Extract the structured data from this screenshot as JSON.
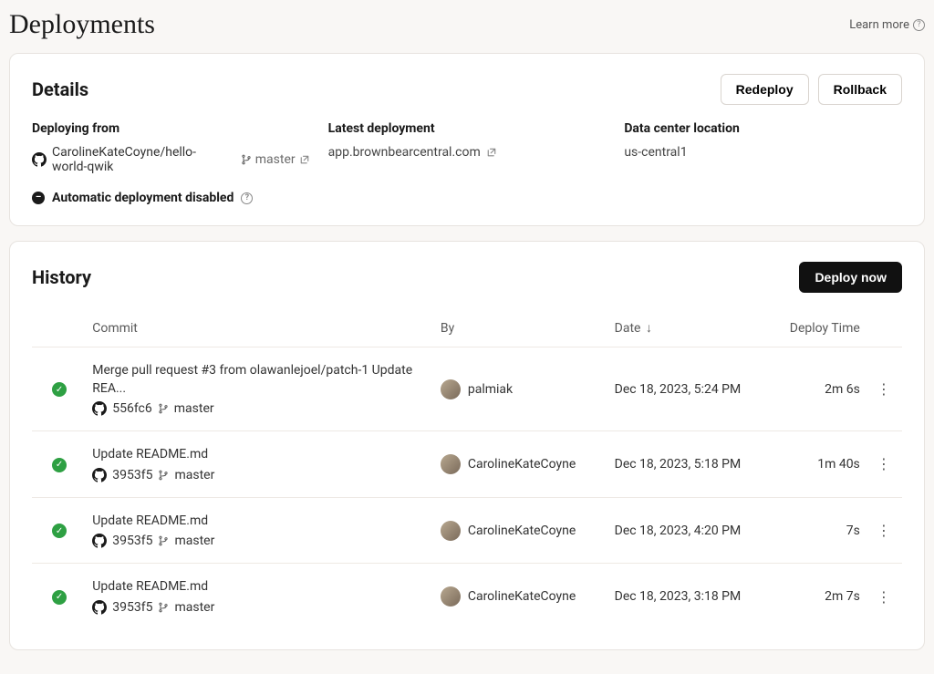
{
  "header": {
    "title": "Deployments",
    "learn_more": "Learn more"
  },
  "details": {
    "title": "Details",
    "redeploy_label": "Redeploy",
    "rollback_label": "Rollback",
    "deploying_from_label": "Deploying from",
    "repo": "CarolineKateCoyne/hello-world-qwik",
    "branch": "master",
    "latest_deployment_label": "Latest deployment",
    "latest_deployment_url": "app.brownbearcentral.com",
    "datacenter_label": "Data center location",
    "datacenter_value": "us-central1",
    "auto_deploy_disabled": "Automatic deployment disabled"
  },
  "history": {
    "title": "History",
    "deploy_now_label": "Deploy now",
    "columns": {
      "commit": "Commit",
      "by": "By",
      "date": "Date",
      "deploy_time": "Deploy Time"
    },
    "rows": [
      {
        "message": "Merge pull request #3 from olawanlejoel/patch-1 Update REA...",
        "hash": "556fc6",
        "branch": "master",
        "by": "palmiak",
        "date": "Dec 18, 2023, 5:24 PM",
        "deploy_time": "2m 6s"
      },
      {
        "message": "Update README.md",
        "hash": "3953f5",
        "branch": "master",
        "by": "CarolineKateCoyne",
        "date": "Dec 18, 2023, 5:18 PM",
        "deploy_time": "1m 40s"
      },
      {
        "message": "Update README.md",
        "hash": "3953f5",
        "branch": "master",
        "by": "CarolineKateCoyne",
        "date": "Dec 18, 2023, 4:20 PM",
        "deploy_time": "7s"
      },
      {
        "message": "Update README.md",
        "hash": "3953f5",
        "branch": "master",
        "by": "CarolineKateCoyne",
        "date": "Dec 18, 2023, 3:18 PM",
        "deploy_time": "2m 7s"
      }
    ]
  }
}
